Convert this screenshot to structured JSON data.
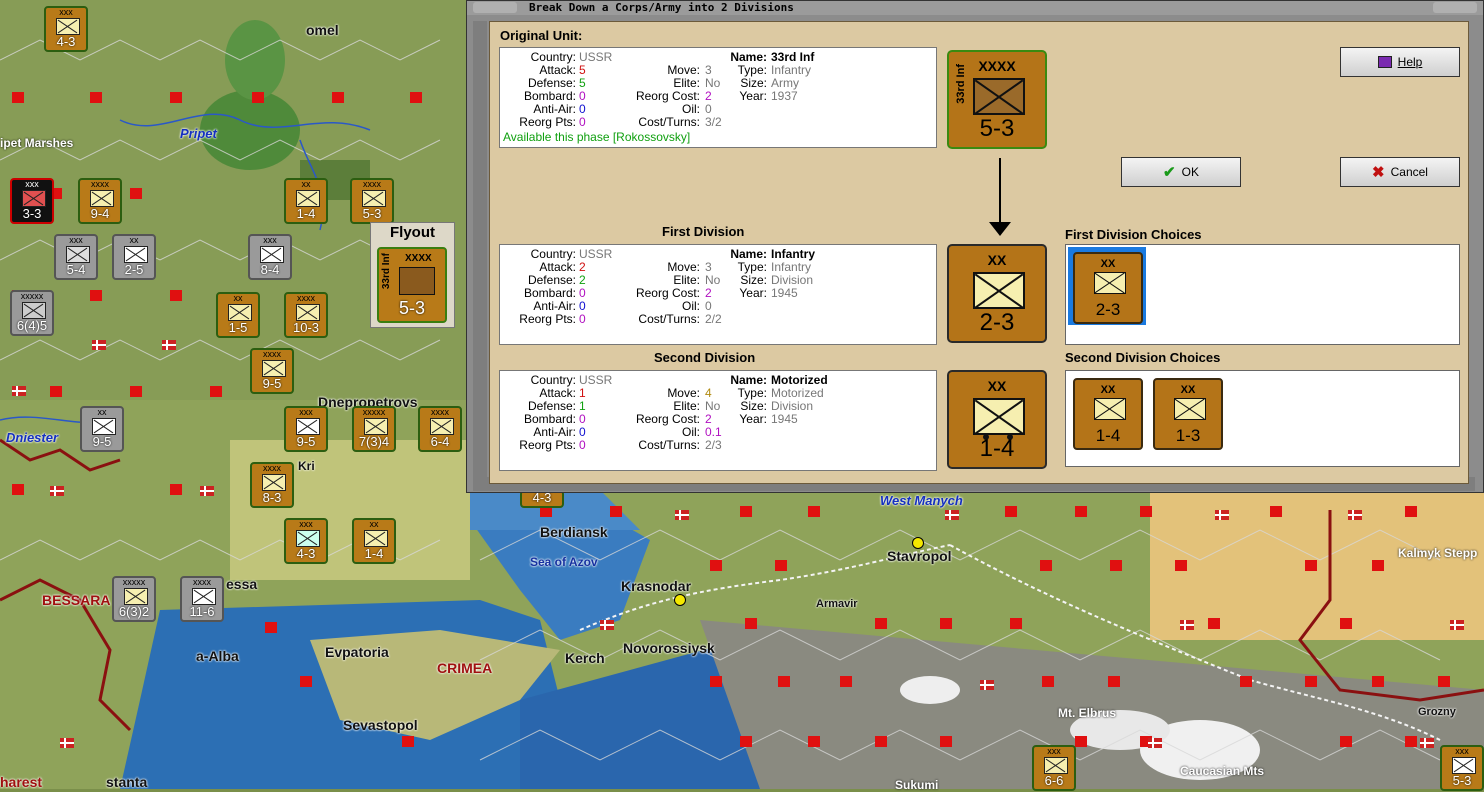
{
  "map": {
    "labels": {
      "pripet_marshes": "ipet Marshes",
      "pripet": "Pripet",
      "dniester": "Dniester",
      "bessarabia": "BESSARA",
      "odessa": "essa",
      "cetatea_alba": "a-Alba",
      "evpatoria": "Evpatoria",
      "crimea": "CRIMEA",
      "sevastopol": "Sevastopol",
      "kerch": "Kerch",
      "novorossiysk": "Novorossiysk",
      "krasnodar": "Krasnodar",
      "berdiansk": "Berdiansk",
      "sea_of_azov": "Sea of Azov",
      "west_manych": "West Manych",
      "stavropol": "Stavropol",
      "armavir": "Armavir",
      "kalmyk": "Kalmyk Stepp",
      "elbrus": "Mt. Elbrus",
      "grozny": "Grozny",
      "caucasian": "Caucasian Mts",
      "sukumi": "Sukumi",
      "constanta": "stanta",
      "bucharest": "harest",
      "gomel": "omel",
      "dnepropetrovsk": "Dnepropetrovs",
      "kri": "Kri"
    },
    "units": [
      {
        "val": "4-3",
        "size": "xxx"
      },
      {
        "val": "9-4",
        "size": "xxxx"
      },
      {
        "val": "1-4",
        "size": "xx"
      },
      {
        "val": "5-3",
        "size": "xxxx"
      },
      {
        "val": "3-3",
        "size": "xxx"
      },
      {
        "val": "5-4",
        "size": "xxx"
      },
      {
        "val": "2-5",
        "size": "xx"
      },
      {
        "val": "8-4",
        "size": "xxx"
      },
      {
        "val": "6(4)5",
        "size": "xxxxx"
      },
      {
        "val": "1-5",
        "size": "xx"
      },
      {
        "val": "10-3",
        "size": "xxxx"
      },
      {
        "val": "9-5",
        "size": "xxxx"
      },
      {
        "val": "9-5",
        "size": "xx"
      },
      {
        "val": "9-5",
        "size": "xxx"
      },
      {
        "val": "7(3)4",
        "size": "xxxxx"
      },
      {
        "val": "6-4",
        "size": "xxxx"
      },
      {
        "val": "8-3",
        "size": "xxxx"
      },
      {
        "val": "4-3",
        "size": "xxx"
      },
      {
        "val": "1-4",
        "size": "xx"
      },
      {
        "val": "6(3)2",
        "size": "xxxxx"
      },
      {
        "val": "11-6",
        "size": "xxxx"
      },
      {
        "val": "4-3",
        "size": "xxx"
      },
      {
        "val": "6-6",
        "size": "xxx"
      },
      {
        "val": "5-3",
        "size": "xxx"
      }
    ]
  },
  "flyout": {
    "title": "Flyout",
    "unit_name": "33rd Inf",
    "unit_size": "XXXX",
    "unit_value": "5-3"
  },
  "dialog": {
    "title": "Break Down a Corps/Army into 2 Divisions",
    "original_label": "Original Unit:",
    "first_label": "First Division",
    "second_label": "Second Division",
    "first_choices_label": "First Division Choices",
    "second_choices_label": "Second Division Choices",
    "buttons": {
      "help": "Help",
      "ok": "OK",
      "cancel": "Cancel"
    },
    "field_labels": {
      "country": "Country:",
      "attack": "Attack:",
      "defense": "Defense:",
      "bombard": "Bombard:",
      "antiair": "Anti-Air:",
      "reorg_pts": "Reorg Pts:",
      "move": "Move:",
      "elite": "Elite:",
      "reorg_cost": "Reorg Cost:",
      "oil": "Oil:",
      "cost_turns": "Cost/Turns:",
      "name": "Name:",
      "type": "Type:",
      "size": "Size:",
      "year": "Year:"
    },
    "original": {
      "country": "USSR",
      "attack": "5",
      "defense": "5",
      "bombard": "0",
      "antiair": "0",
      "reorg_pts": "0",
      "move": "3",
      "elite": "No",
      "reorg_cost": "2",
      "oil": "0",
      "cost_turns": "3/2",
      "name": "33rd Inf",
      "type": "Infantry",
      "size": "Army",
      "year": "1937",
      "available": "Available this phase [Rokossovsky]",
      "counter_size": "XXXX",
      "counter_value": "5-3",
      "counter_name": "33rd Inf"
    },
    "first": {
      "country": "USSR",
      "attack": "2",
      "defense": "2",
      "bombard": "0",
      "antiair": "0",
      "reorg_pts": "0",
      "move": "3",
      "elite": "No",
      "reorg_cost": "2",
      "oil": "0",
      "cost_turns": "2/2",
      "name": "Infantry",
      "type": "Infantry",
      "size": "Division",
      "year": "1945",
      "counter_size": "XX",
      "counter_value": "2-3"
    },
    "second": {
      "country": "USSR",
      "attack": "1",
      "defense": "1",
      "bombard": "0",
      "antiair": "0",
      "reorg_pts": "0",
      "move": "4",
      "elite": "No",
      "reorg_cost": "2",
      "oil": "0.1",
      "cost_turns": "2/3",
      "name": "Motorized",
      "type": "Motorized",
      "size": "Division",
      "year": "1945",
      "counter_size": "XX",
      "counter_value": "1-4"
    },
    "first_choices": [
      {
        "size": "XX",
        "value": "2-3"
      }
    ],
    "second_choices": [
      {
        "size": "XX",
        "value": "1-4"
      },
      {
        "size": "XX",
        "value": "1-3"
      }
    ]
  }
}
